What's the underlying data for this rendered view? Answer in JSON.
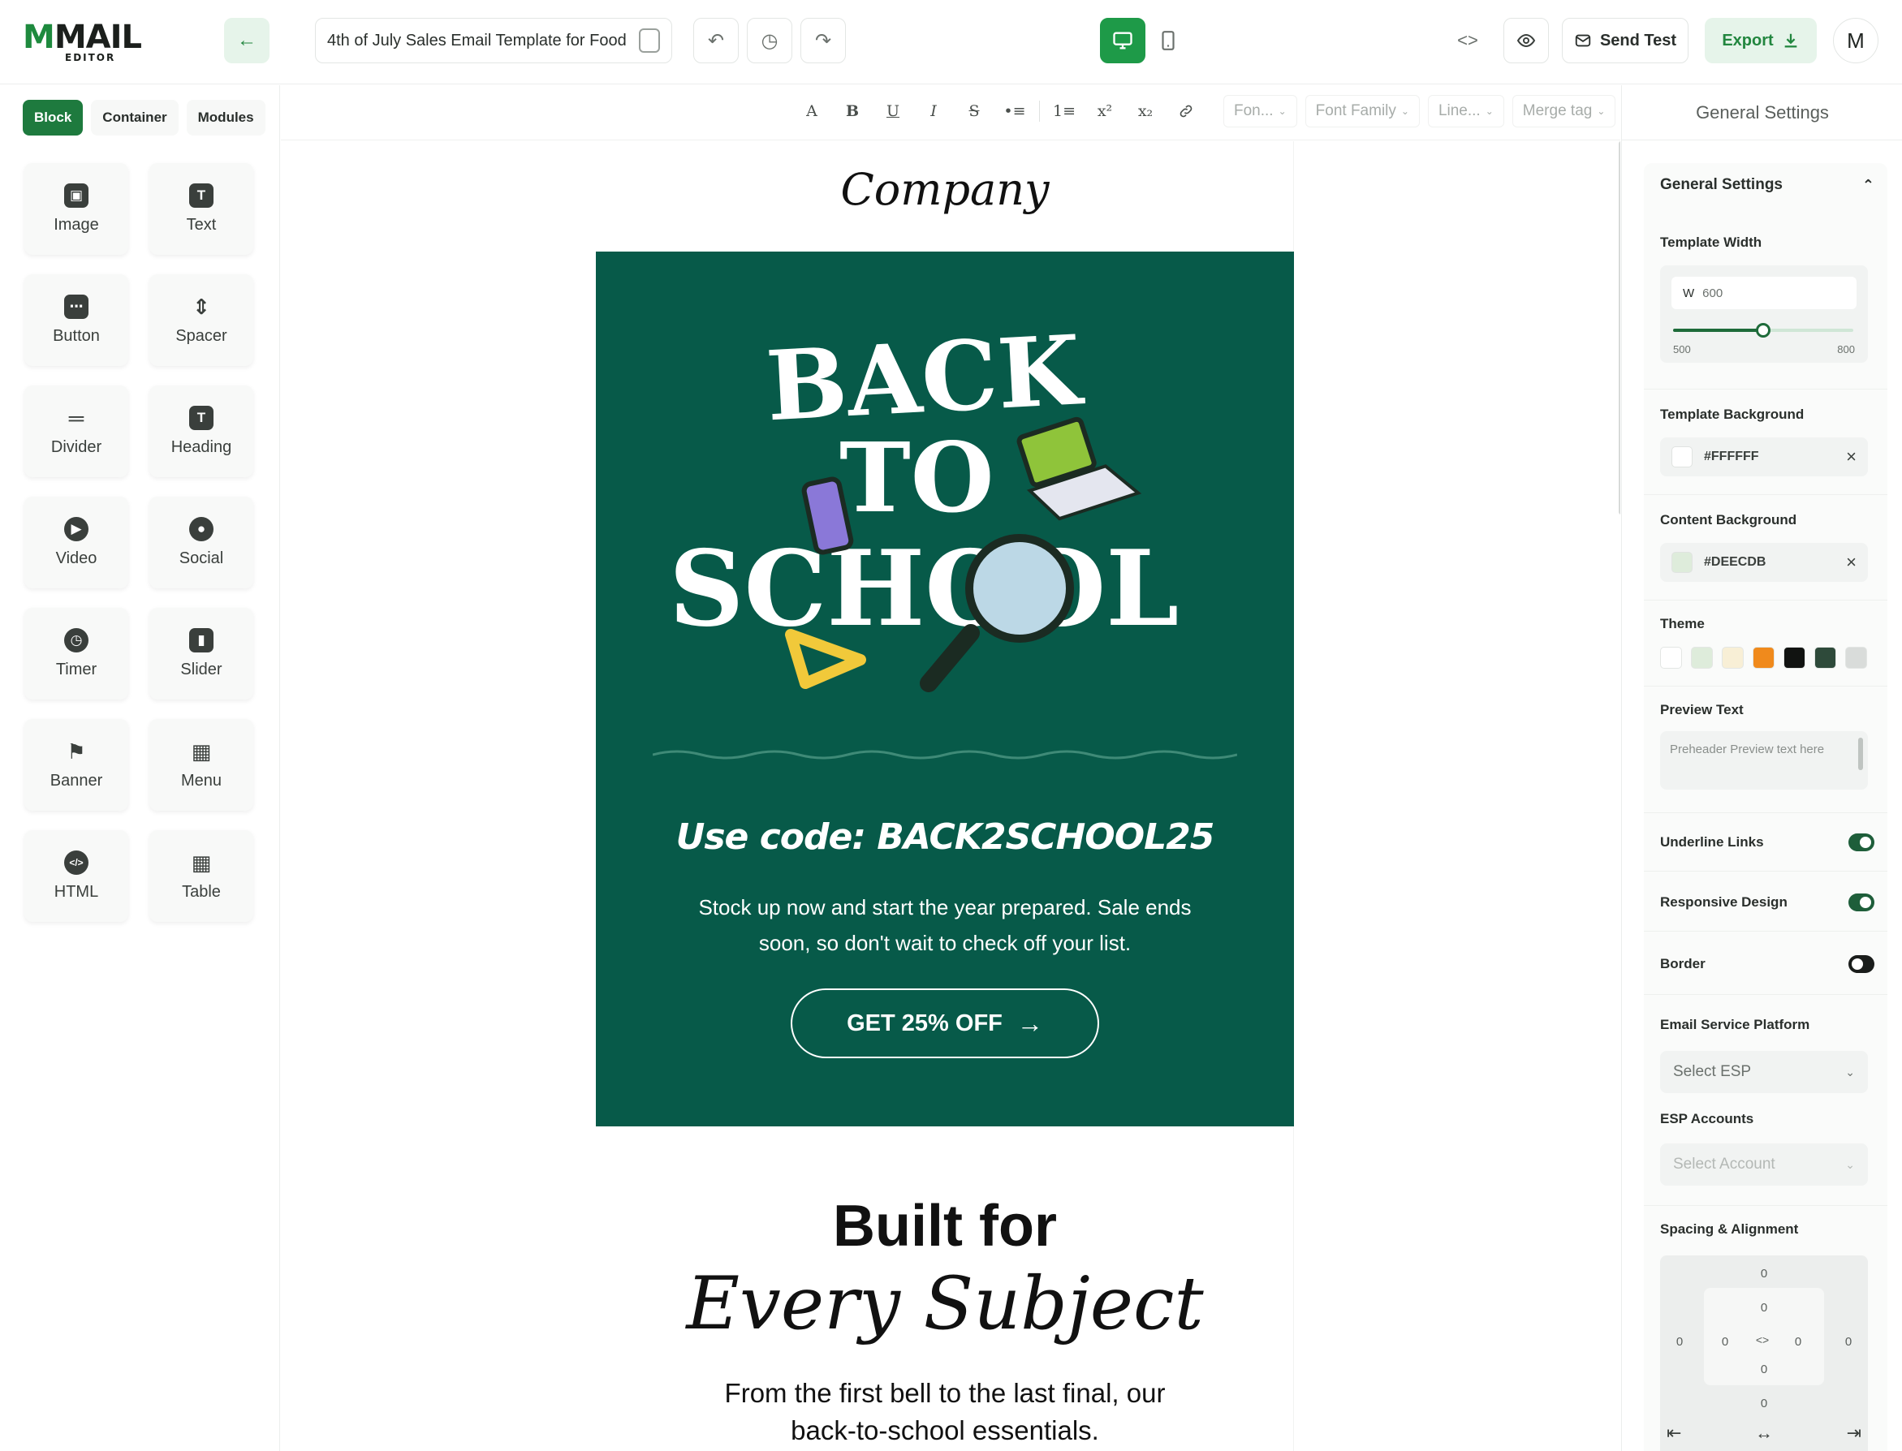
{
  "app": {
    "logo_text": "MAIL",
    "logo_sub": "EDITOR"
  },
  "topbar": {
    "back_icon": "arrow-left-icon",
    "template_title": "4th of July Sales Email Template for Food",
    "undo_icon": "undo-icon",
    "history_icon": "history-icon",
    "redo_icon": "redo-icon",
    "desktop_view": "desktop-icon",
    "mobile_view": "mobile-icon",
    "code_icon": "code-icon",
    "preview_icon": "eye-icon",
    "send_test_label": "Send Test",
    "export_label": "Export",
    "avatar_initial": "M"
  },
  "left_panel": {
    "tabs": [
      {
        "label": "Block",
        "active": true
      },
      {
        "label": "Container",
        "active": false
      },
      {
        "label": "Modules",
        "active": false
      }
    ],
    "blocks": [
      {
        "label": "Image",
        "icon": "image-icon"
      },
      {
        "label": "Text",
        "icon": "text-icon"
      },
      {
        "label": "Button",
        "icon": "button-icon"
      },
      {
        "label": "Spacer",
        "icon": "spacer-icon"
      },
      {
        "label": "Divider",
        "icon": "divider-icon"
      },
      {
        "label": "Heading",
        "icon": "heading-icon"
      },
      {
        "label": "Video",
        "icon": "video-icon"
      },
      {
        "label": "Social",
        "icon": "social-icon"
      },
      {
        "label": "Timer",
        "icon": "timer-icon"
      },
      {
        "label": "Slider",
        "icon": "slider-icon"
      },
      {
        "label": "Banner",
        "icon": "banner-icon"
      },
      {
        "label": "Menu",
        "icon": "menu-icon"
      },
      {
        "label": "HTML",
        "icon": "html-icon"
      },
      {
        "label": "Table",
        "icon": "table-icon"
      }
    ]
  },
  "format_toolbar": {
    "buttons": [
      "A",
      "B",
      "U",
      "I",
      "S",
      "•≡",
      "1≡",
      "x²",
      "x₂",
      "🔗"
    ],
    "font_size_placeholder": "Fon...",
    "font_family_placeholder": "Font Family",
    "line_height_placeholder": "Line...",
    "merge_tag_placeholder": "Merge tag"
  },
  "email": {
    "company": "Company",
    "hero_line1": "BACK",
    "hero_line2": "TO",
    "hero_line3": "SCHOOL",
    "promo_code": "Use code: BACK2SCHOOL25",
    "hero_copy": "Stock up now and start the year prepared. Sale ends soon, so don't wait to check off your list.",
    "cta_label": "GET 25% OFF",
    "section_title": "Built for",
    "section_title_italic": "Every Subject",
    "section_copy": "From the first bell to the last final, our back-to-school essentials.",
    "colors": {
      "hero_bg": "#075A49",
      "accent": "#1E9A48"
    }
  },
  "right_panel": {
    "header": "General Settings",
    "section_title": "General Settings",
    "template_width_label": "Template Width",
    "width_prefix": "W",
    "width_value": "600",
    "width_min": "500",
    "width_max": "800",
    "width_fraction": 0.5,
    "template_bg_label": "Template Background",
    "template_bg_value": "#FFFFFF",
    "content_bg_label": "Content Background",
    "content_bg_value": "#DEECDB",
    "theme_label": "Theme",
    "theme_colors": [
      "#FFFFFF",
      "#DEECDB",
      "#F8EFD6",
      "#F08A1C",
      "#111311",
      "#2E4A3A",
      "#D9DCDA"
    ],
    "preview_text_label": "Preview Text",
    "preview_text_placeholder": "Preheader Preview text here",
    "underline_links_label": "Underline Links",
    "underline_links_on": true,
    "responsive_label": "Responsive Design",
    "responsive_on": true,
    "border_label": "Border",
    "border_on": false,
    "esp_label": "Email Service Platform",
    "esp_placeholder": "Select ESP",
    "esp_accounts_label": "ESP Accounts",
    "esp_accounts_placeholder": "Select Account",
    "spacing_label": "Spacing & Alignment",
    "spacing_values": [
      "0",
      "0",
      "0",
      "0",
      "0",
      "0",
      "0",
      "0"
    ]
  }
}
